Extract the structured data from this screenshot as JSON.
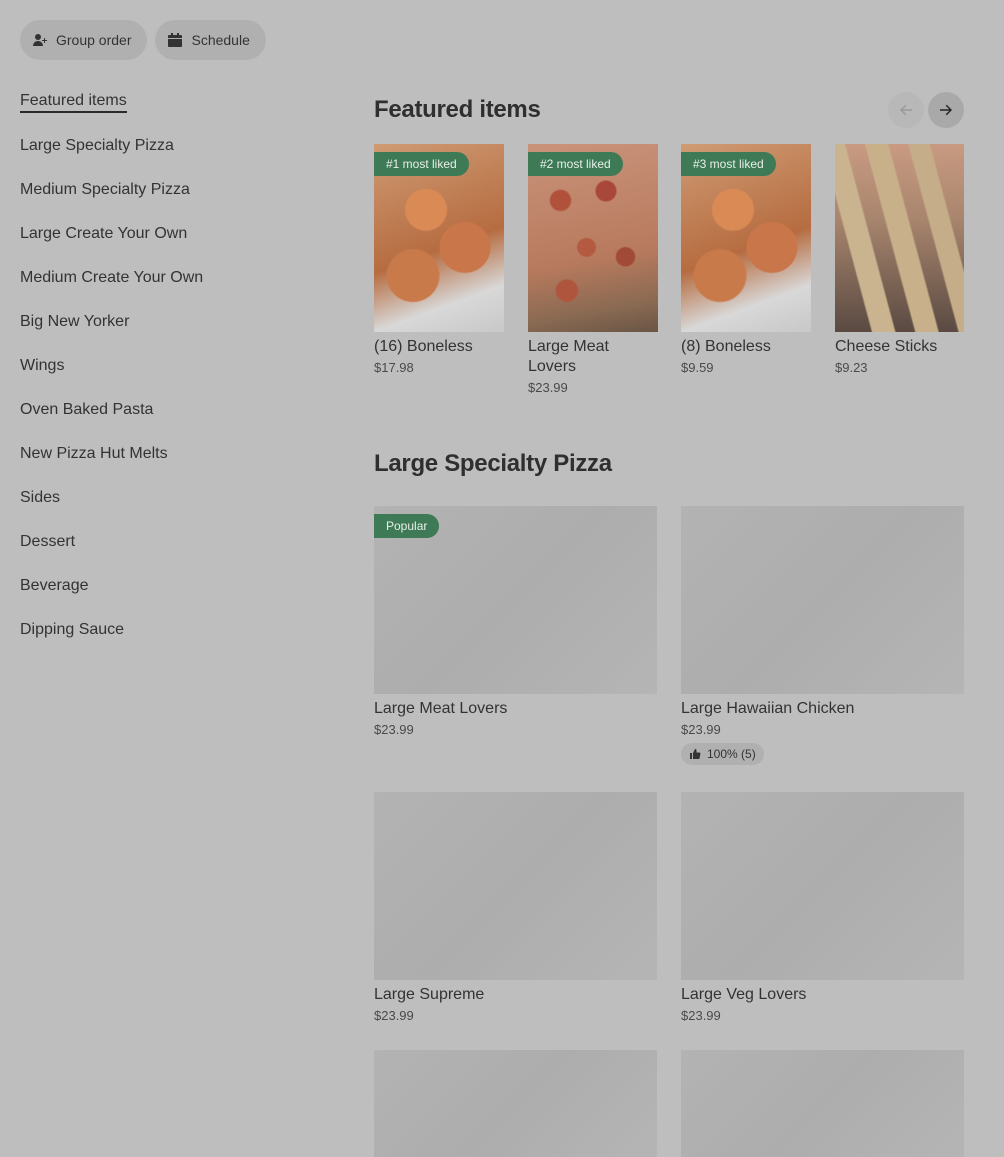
{
  "top_actions": {
    "group_order_label": "Group order",
    "schedule_label": "Schedule"
  },
  "sidebar": {
    "items": [
      {
        "label": "Featured items"
      },
      {
        "label": "Large Specialty Pizza"
      },
      {
        "label": "Medium Specialty Pizza"
      },
      {
        "label": "Large Create Your Own"
      },
      {
        "label": "Medium Create Your Own"
      },
      {
        "label": "Big New Yorker"
      },
      {
        "label": "Wings"
      },
      {
        "label": "Oven Baked Pasta"
      },
      {
        "label": "New Pizza Hut Melts"
      },
      {
        "label": "Sides"
      },
      {
        "label": "Dessert"
      },
      {
        "label": "Beverage"
      },
      {
        "label": "Dipping Sauce"
      }
    ]
  },
  "featured": {
    "title": "Featured items",
    "items": [
      {
        "badge": "#1 most liked",
        "name": "(16) Boneless",
        "price": "$17.98"
      },
      {
        "badge": "#2 most liked",
        "name": "Large Meat Lovers",
        "price": "$23.99"
      },
      {
        "badge": "#3 most liked",
        "name": "(8) Boneless",
        "price": "$9.59"
      },
      {
        "badge": "",
        "name": "Cheese Sticks",
        "price": "$9.23"
      }
    ]
  },
  "specialty": {
    "title": "Large Specialty Pizza",
    "items": [
      {
        "badge": "Popular",
        "name": "Large Meat Lovers",
        "price": "$23.99",
        "rating": ""
      },
      {
        "badge": "",
        "name": "Large Hawaiian Chicken",
        "price": "$23.99",
        "rating": "100% (5)"
      },
      {
        "badge": "",
        "name": "Large Supreme",
        "price": "$23.99",
        "rating": ""
      },
      {
        "badge": "",
        "name": "Large Veg Lovers",
        "price": "$23.99",
        "rating": ""
      }
    ]
  },
  "colors": {
    "badge_green": "#3f7a56",
    "overlay_gray": "#bebebe"
  }
}
